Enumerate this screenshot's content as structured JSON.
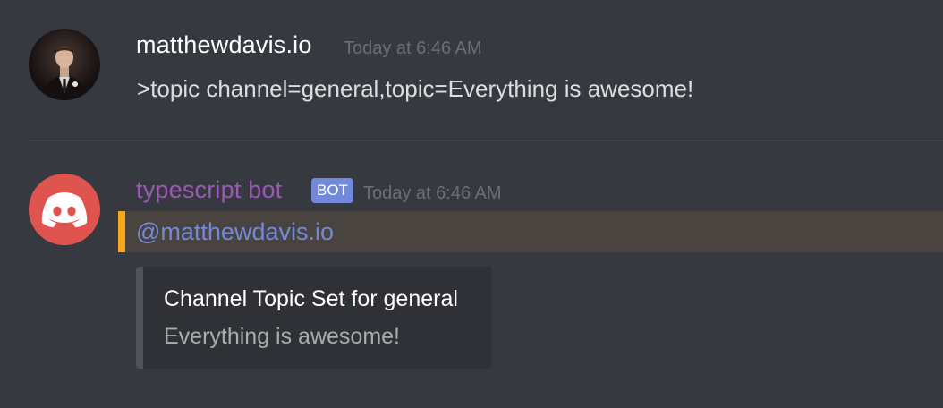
{
  "messages": [
    {
      "author": "matthewdavis.io",
      "timestamp": "Today at 6:46 AM",
      "content": ">topic channel=general,topic=Everything is awesome!",
      "author_color": "#ffffff"
    },
    {
      "author": "typescript bot",
      "badge": "BOT",
      "timestamp": "Today at 6:46 AM",
      "mention": "@matthewdavis.io",
      "author_color": "#9b59b6",
      "embed": {
        "title": "Channel Topic Set for general",
        "description": "Everything is awesome!"
      }
    }
  ],
  "colors": {
    "background": "#36393f",
    "mention_highlight": "#faa61a",
    "mention_text": "#7289da",
    "bot_avatar": "#e0544f",
    "bot_badge": "#7289da",
    "embed_background": "#2f3136"
  },
  "icons": {
    "bot_avatar": "discord-logo-icon",
    "user_avatar": "user-photo-avatar"
  }
}
